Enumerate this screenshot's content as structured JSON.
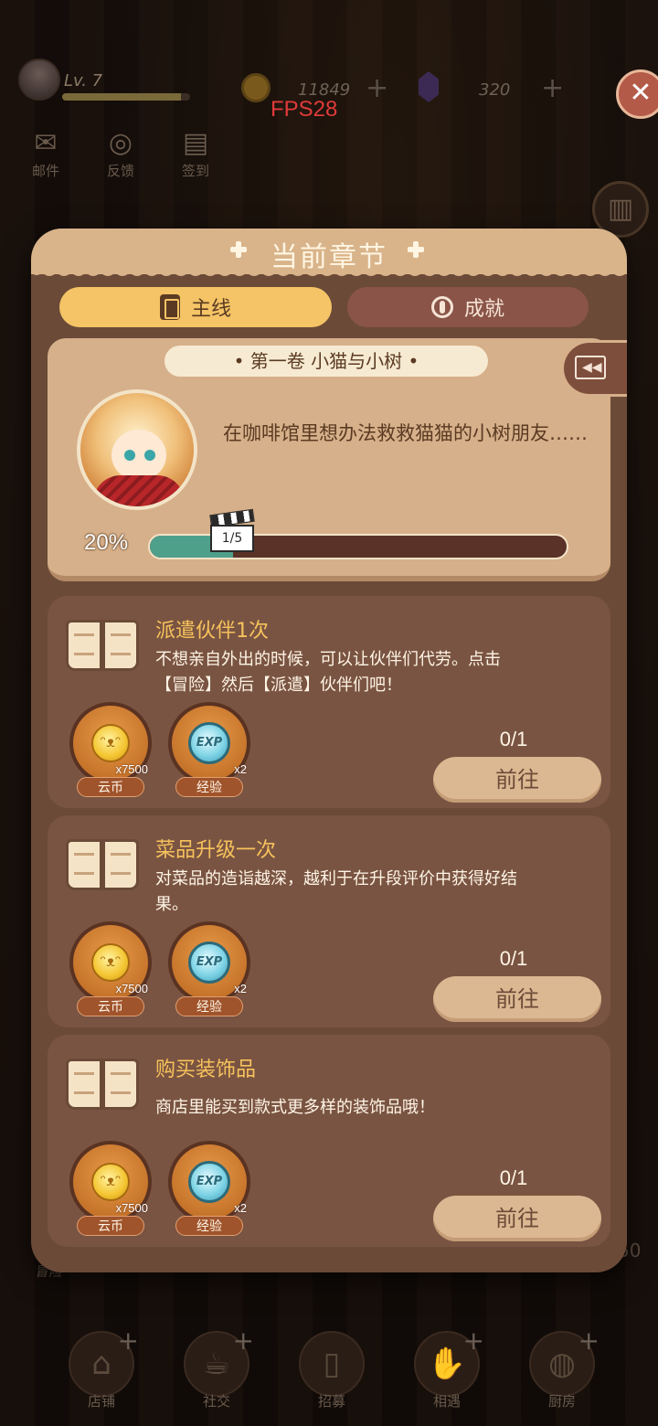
{
  "hud": {
    "level": "Lv. 7",
    "coins": "11849",
    "gems": "320",
    "fps": "FPS28",
    "plus_symbol": "+",
    "close_symbol": "✕"
  },
  "side_icons": [
    {
      "label": "邮件",
      "icon": "mail-icon"
    },
    {
      "label": "反馈",
      "icon": "feedback-icon"
    },
    {
      "label": "签到",
      "icon": "checkin-icon"
    }
  ],
  "bottom_nav": [
    {
      "label": "店铺",
      "icon": "shop-icon"
    },
    {
      "label": "社交",
      "icon": "coffee-icon"
    },
    {
      "label": "招募",
      "icon": "recruit-icon"
    },
    {
      "label": "相遇",
      "icon": "handshake-icon"
    },
    {
      "label": "厨房",
      "icon": "kitchen-icon"
    }
  ],
  "background": {
    "adventure_label": "冒险",
    "corner_number": "50"
  },
  "panel": {
    "title": "当前章节",
    "tabs": [
      {
        "label": "主线",
        "active": true,
        "icon": "scroll-icon"
      },
      {
        "label": "成就",
        "active": false,
        "icon": "medal-icon"
      }
    ],
    "chapter": {
      "volume": "• 第一卷 小猫与小树 •",
      "description": "在咖啡馆里想办法救救猫猫的小树朋友……",
      "progress_percent": 20,
      "progress_label": "20%",
      "progress_count": "1/5"
    },
    "tasks": [
      {
        "title": "派遣伙伴1次",
        "description": "不想亲自外出的时候，可以让伙伴们代劳。点击【冒险】然后【派遣】伙伴们吧！",
        "count": "0/1",
        "button": "前往",
        "rewards": [
          {
            "name": "云币",
            "quantity": "x7500",
            "icon": "cat-coin-icon"
          },
          {
            "name": "经验",
            "quantity": "x2",
            "icon": "exp-icon",
            "icon_text": "EXP"
          }
        ]
      },
      {
        "title": "菜品升级一次",
        "description": "对菜品的造诣越深，越利于在升段评价中获得好结果。",
        "count": "0/1",
        "button": "前往",
        "rewards": [
          {
            "name": "云币",
            "quantity": "x7500",
            "icon": "cat-coin-icon"
          },
          {
            "name": "经验",
            "quantity": "x2",
            "icon": "exp-icon",
            "icon_text": "EXP"
          }
        ]
      },
      {
        "title": "购买装饰品",
        "description": "商店里能买到款式更多样的装饰品哦！",
        "count": "0/1",
        "button": "前往",
        "rewards": [
          {
            "name": "云币",
            "quantity": "x7500",
            "icon": "cat-coin-icon"
          },
          {
            "name": "经验",
            "quantity": "x2",
            "icon": "exp-icon",
            "icon_text": "EXP"
          }
        ]
      }
    ]
  },
  "colors": {
    "panel": "#6b4a38",
    "tab_active": "#f4c466",
    "task_title": "#f6c25c",
    "progress_fill": "#4fa08a"
  }
}
